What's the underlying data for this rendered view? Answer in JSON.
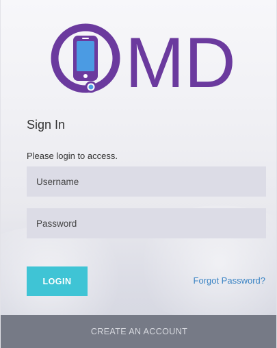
{
  "logo": {
    "text": "MD",
    "color": "#6b3a9e",
    "icon": "phone-icon"
  },
  "signin": {
    "heading": "Sign In",
    "subtext": "Please login to access.",
    "username_placeholder": "Username",
    "password_placeholder": "Password",
    "login_label": "LOGIN",
    "forgot_label": "Forgot Password?"
  },
  "footer": {
    "create_account_label": "CREATE AN ACCOUNT"
  },
  "colors": {
    "brand": "#6b3a9e",
    "accent": "#3fc4d5",
    "link": "#3b84c4",
    "footer": "#767a86"
  }
}
